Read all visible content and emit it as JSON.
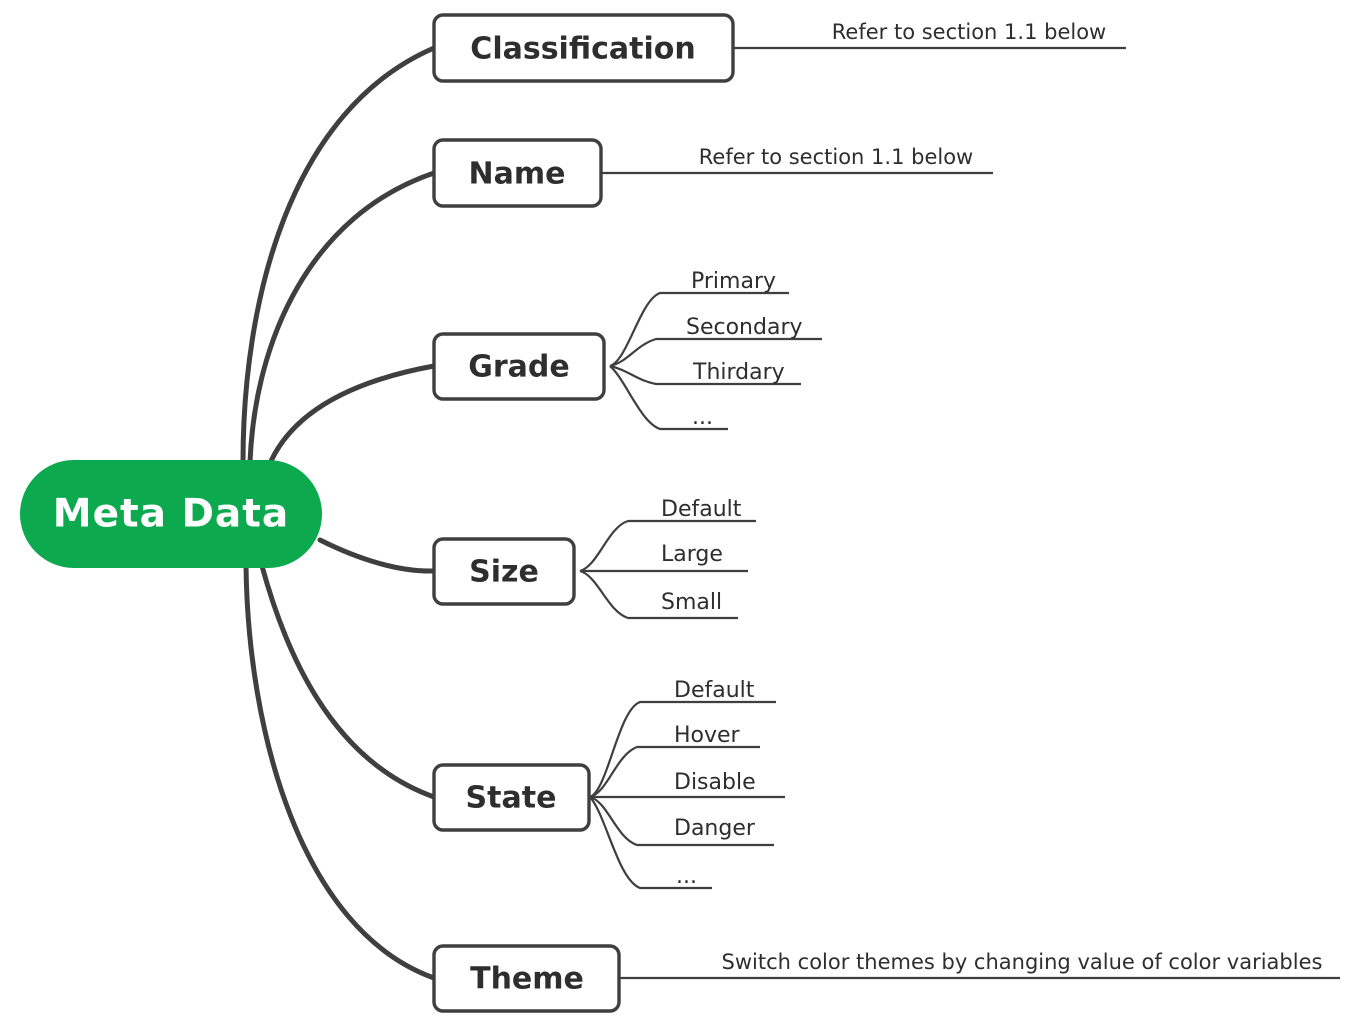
{
  "diagram": {
    "type": "mindmap",
    "title": "Meta Data",
    "colors": {
      "root_fill": "#0CA94F",
      "root_text": "#FFFFFF",
      "line": "#3F3F3F",
      "node_fill": "#FFFFFF",
      "node_text": "#2E2E2E",
      "background": "#FFFFFF"
    }
  },
  "root": {
    "label": "Meta Data"
  },
  "branches": [
    {
      "label": "Classification",
      "annotation": "Refer to section 1.1 below",
      "children": []
    },
    {
      "label": "Name",
      "annotation": "Refer to section 1.1 below",
      "children": []
    },
    {
      "label": "Grade",
      "annotation": "",
      "children": [
        {
          "label": "Primary"
        },
        {
          "label": "Secondary"
        },
        {
          "label": "Thirdary"
        },
        {
          "label": "..."
        }
      ]
    },
    {
      "label": "Size",
      "annotation": "",
      "children": [
        {
          "label": "Default"
        },
        {
          "label": "Large"
        },
        {
          "label": "Small"
        }
      ]
    },
    {
      "label": "State",
      "annotation": "",
      "children": [
        {
          "label": "Default"
        },
        {
          "label": "Hover"
        },
        {
          "label": "Disable"
        },
        {
          "label": "Danger"
        },
        {
          "label": "..."
        }
      ]
    },
    {
      "label": "Theme",
      "annotation": "Switch color themes by changing value of  color variables",
      "children": []
    }
  ]
}
